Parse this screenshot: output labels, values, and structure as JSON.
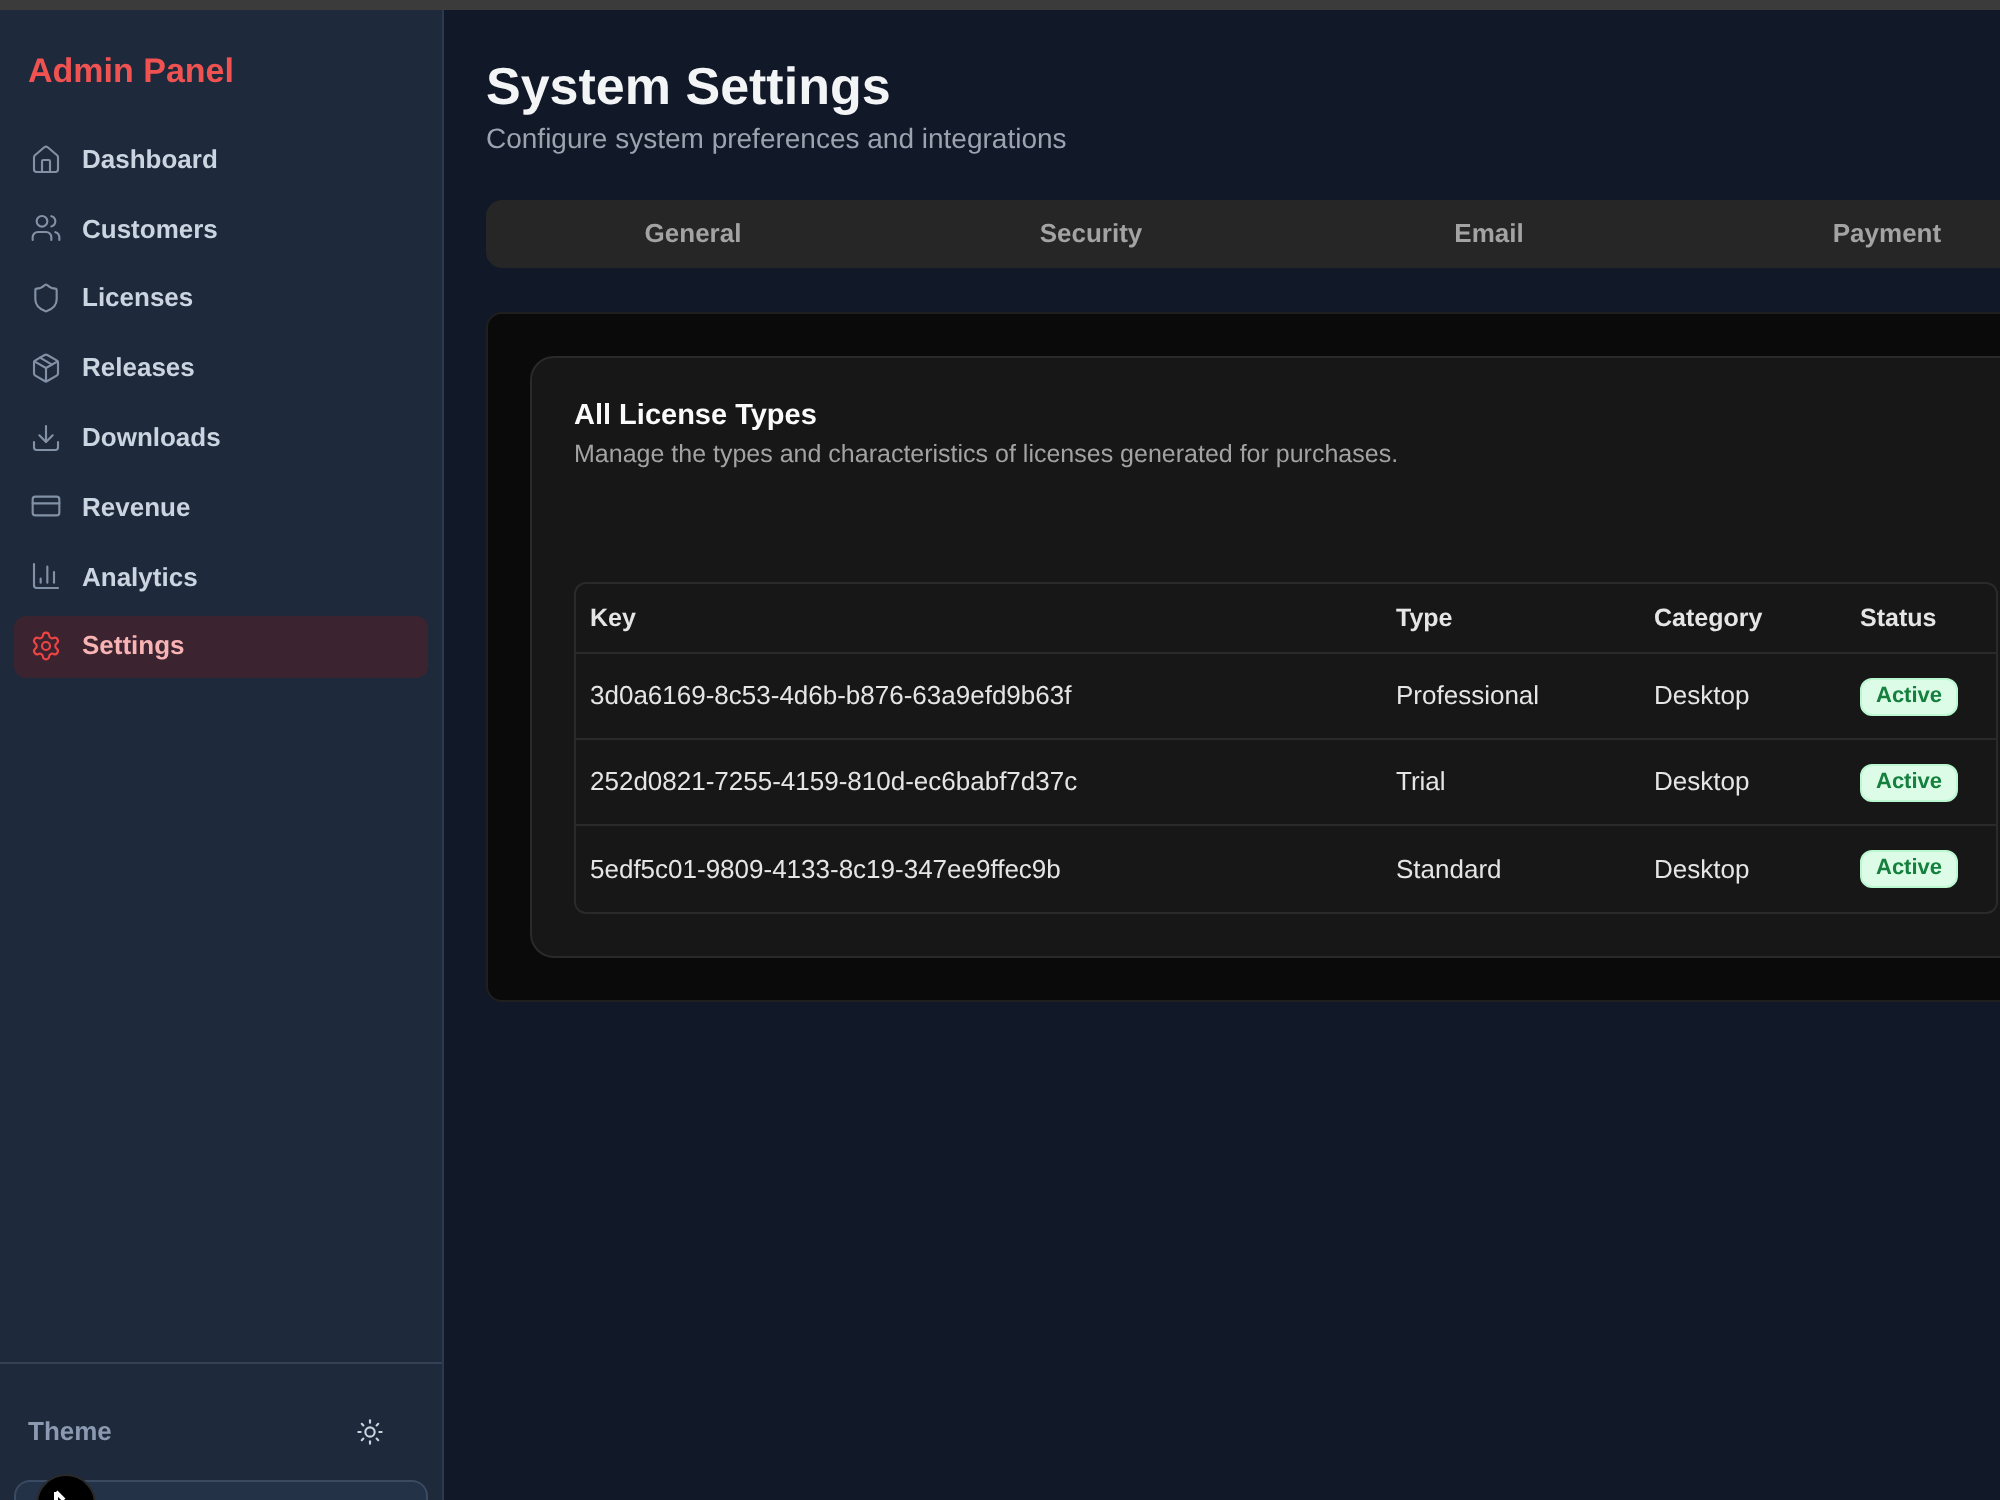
{
  "sidebar": {
    "title": "Admin Panel",
    "items": [
      {
        "label": "Dashboard",
        "selected": false
      },
      {
        "label": "Customers",
        "selected": false
      },
      {
        "label": "Licenses",
        "selected": false
      },
      {
        "label": "Releases",
        "selected": false
      },
      {
        "label": "Downloads",
        "selected": false
      },
      {
        "label": "Revenue",
        "selected": false
      },
      {
        "label": "Analytics",
        "selected": false
      },
      {
        "label": "Settings",
        "selected": true
      }
    ],
    "theme_label": "Theme"
  },
  "header": {
    "title": "System Settings",
    "subtitle": "Configure system preferences and integrations"
  },
  "tabs": [
    {
      "label": "General",
      "selected": false
    },
    {
      "label": "Security",
      "selected": false
    },
    {
      "label": "Email",
      "selected": false
    },
    {
      "label": "Payment",
      "selected": false
    }
  ],
  "card": {
    "title": "All License Types",
    "description": "Manage the types and characteristics of licenses generated for purchases.",
    "table": {
      "columns": [
        "Key",
        "Type",
        "Category",
        "Status"
      ],
      "rows": [
        {
          "key": "3d0a6169-8c53-4d6b-b876-63a9efd9b63f",
          "type": "Professional",
          "category": "Desktop",
          "status": "Active"
        },
        {
          "key": "252d0821-7255-4159-810d-ec6babf7d37c",
          "type": "Trial",
          "category": "Desktop",
          "status": "Active"
        },
        {
          "key": "5edf5c01-9809-4133-8c19-347ee9ffec9b",
          "type": "Standard",
          "category": "Desktop",
          "status": "Active"
        }
      ]
    }
  }
}
